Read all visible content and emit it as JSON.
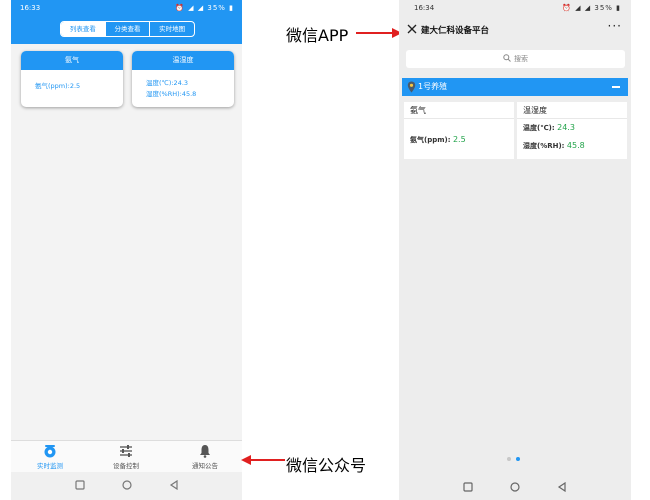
{
  "left_phone": {
    "status_time": "16:33",
    "status_right": "⏰ ◢ ◢ 35% ▮",
    "tabs": [
      {
        "label": "列表查看",
        "active": true
      },
      {
        "label": "分类查看",
        "active": false
      },
      {
        "label": "实时地图",
        "active": false
      }
    ],
    "cards": [
      {
        "title": "氨气",
        "lines": [
          "氨气(ppm):2.5"
        ]
      },
      {
        "title": "温湿度",
        "lines": [
          "温度(℃):24.3",
          "湿度(%RH):45.8"
        ]
      }
    ],
    "bottom_nav": [
      {
        "label": "实时监测",
        "icon": "monitor-icon",
        "active": true
      },
      {
        "label": "设备控制",
        "icon": "sliders-icon",
        "active": false
      },
      {
        "label": "通知公告",
        "icon": "bell-icon",
        "active": false
      }
    ]
  },
  "annotations": {
    "app_label": "微信APP",
    "oa_label": "微信公众号"
  },
  "right_phone": {
    "status_time": "16:34",
    "status_right": "⏰ ◢ ◢ 35% ▮",
    "title": "建大仁科设备平台",
    "search_placeholder": "搜索",
    "group_label": "1号养殖",
    "cards": [
      {
        "title": "氨气",
        "rows": [
          {
            "label": "氨气(ppm):",
            "value": "2.5"
          }
        ]
      },
      {
        "title": "温湿度",
        "rows": [
          {
            "label": "温度(℃):",
            "value": "24.3"
          },
          {
            "label": "湿度(%RH):",
            "value": "45.8"
          }
        ]
      }
    ]
  },
  "colors": {
    "accent": "#2196f3",
    "value_green": "#22a34a",
    "arrow_red": "#e02020"
  }
}
